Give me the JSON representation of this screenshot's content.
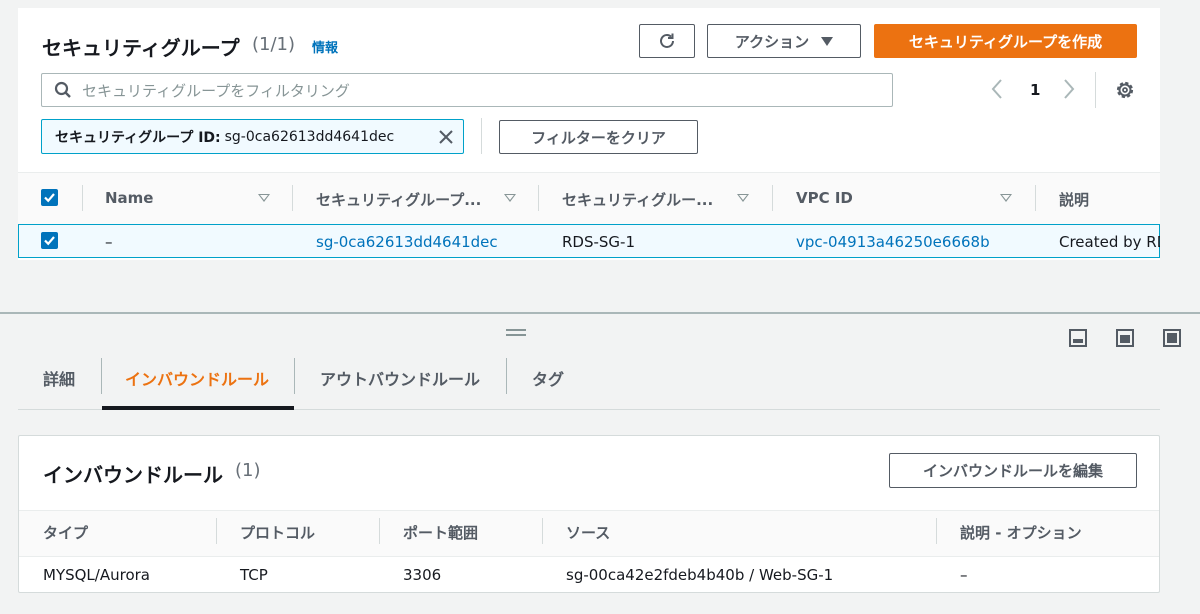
{
  "security_groups": {
    "title": "セキュリティグループ",
    "count": "(1/1)",
    "info_link": "情報",
    "actions_label": "アクション",
    "create_label": "セキュリティグループを作成",
    "search_placeholder": "セキュリティグループをフィルタリング",
    "page_number": "1",
    "filter_token": {
      "label": "セキュリティグループ ID:",
      "value": "sg-0ca62613dd4641dec"
    },
    "clear_filter_label": "フィルターをクリア",
    "columns": [
      "Name",
      "セキュリティグループ...",
      "セキュリティグルー...",
      "VPC ID",
      "説明"
    ],
    "rows": [
      {
        "name": "–",
        "group_id": "sg-0ca62613dd4641dec",
        "group_name": "RDS-SG-1",
        "vpc_id": "vpc-04913a46250e6668b",
        "description": "Created by RDS"
      }
    ]
  },
  "tabs": [
    {
      "label": "詳細",
      "active": false
    },
    {
      "label": "インバウンドルール",
      "active": true
    },
    {
      "label": "アウトバウンドルール",
      "active": false
    },
    {
      "label": "タグ",
      "active": false
    }
  ],
  "inbound": {
    "title": "インバウンドルール",
    "count": "(1)",
    "edit_label": "インバウンドルールを編集",
    "columns": [
      "タイプ",
      "プロトコル",
      "ポート範囲",
      "ソース",
      "説明 - オプション"
    ],
    "rows": [
      {
        "type": "MYSQL/Aurora",
        "protocol": "TCP",
        "port_range": "3306",
        "source": "sg-00ca42e2fdeb4b40b / Web-SG-1",
        "description": "–"
      }
    ]
  },
  "colors": {
    "accent": "#ec7211",
    "link": "#0073bb",
    "selection_border": "#00a1c9"
  },
  "icons": [
    "refresh-icon",
    "caret-down-icon",
    "search-icon",
    "chevron-left-icon",
    "chevron-right-icon",
    "gear-icon",
    "close-icon",
    "checkbox-icon",
    "drag-handle-icon",
    "panel-layout-icon"
  ]
}
